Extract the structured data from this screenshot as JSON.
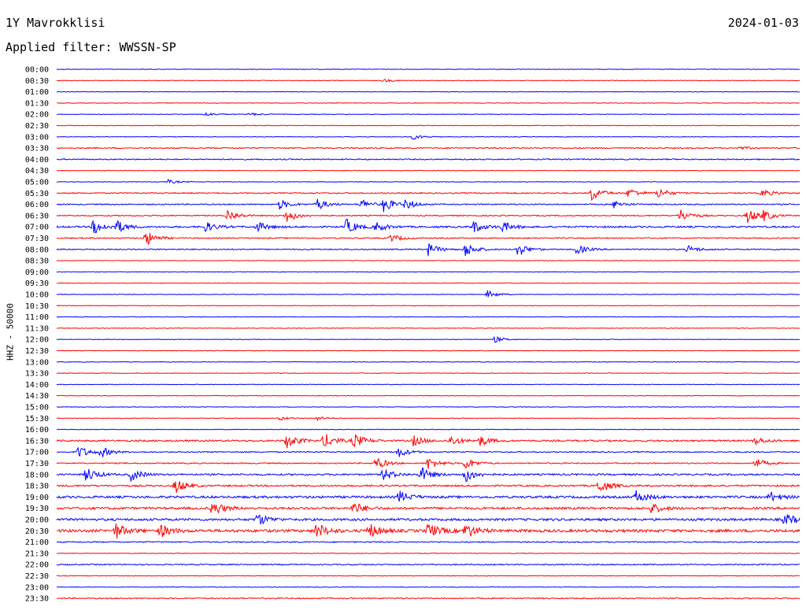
{
  "header": {
    "station": "1Y Mavrokklisi",
    "date": "2024-01-03",
    "filter": "Applied filter: WWSSN-SP"
  },
  "colors": {
    "odd_rows": "#0000ff",
    "even_rows": "#ff0000"
  },
  "chart_data": {
    "type": "line",
    "title": "1Y Mavrokklisi",
    "ylabel": "HHZ - 50000",
    "xlabel": "",
    "row_interval_minutes": 30,
    "rows": [
      {
        "label": "00:00",
        "color": "blue",
        "amplitude": 1,
        "events": []
      },
      {
        "label": "00:30",
        "color": "red",
        "amplitude": 1,
        "events": [
          [
            0.44,
            0.6
          ]
        ]
      },
      {
        "label": "01:00",
        "color": "blue",
        "amplitude": 1,
        "events": []
      },
      {
        "label": "01:30",
        "color": "red",
        "amplitude": 1,
        "events": []
      },
      {
        "label": "02:00",
        "color": "blue",
        "amplitude": 1,
        "events": [
          [
            0.2,
            0.8
          ],
          [
            0.26,
            0.6
          ]
        ]
      },
      {
        "label": "02:30",
        "color": "red",
        "amplitude": 1,
        "events": []
      },
      {
        "label": "03:00",
        "color": "blue",
        "amplitude": 1,
        "events": [
          [
            0.48,
            1.0
          ]
        ]
      },
      {
        "label": "03:30",
        "color": "red",
        "amplitude": 2,
        "events": [
          [
            0.92,
            0.5
          ]
        ]
      },
      {
        "label": "04:00",
        "color": "blue",
        "amplitude": 2,
        "events": []
      },
      {
        "label": "04:30",
        "color": "red",
        "amplitude": 1,
        "events": []
      },
      {
        "label": "05:00",
        "color": "blue",
        "amplitude": 1,
        "events": [
          [
            0.15,
            0.8
          ]
        ]
      },
      {
        "label": "05:30",
        "color": "red",
        "amplitude": 2,
        "events": [
          [
            0.72,
            3.0
          ],
          [
            0.77,
            2.0
          ],
          [
            0.81,
            2.0
          ],
          [
            0.95,
            1.5
          ]
        ]
      },
      {
        "label": "06:00",
        "color": "blue",
        "amplitude": 2,
        "events": [
          [
            0.3,
            2.0
          ],
          [
            0.35,
            2.5
          ],
          [
            0.41,
            2.0
          ],
          [
            0.44,
            3.0
          ],
          [
            0.47,
            2.0
          ],
          [
            0.75,
            1.5
          ]
        ]
      },
      {
        "label": "06:30",
        "color": "red",
        "amplitude": 2,
        "events": [
          [
            0.23,
            2.5
          ],
          [
            0.31,
            2.5
          ],
          [
            0.84,
            2.5
          ],
          [
            0.93,
            3.0
          ],
          [
            0.95,
            2.0
          ]
        ]
      },
      {
        "label": "07:00",
        "color": "blue",
        "amplitude": 3,
        "events": [
          [
            0.05,
            3.0
          ],
          [
            0.08,
            2.5
          ],
          [
            0.2,
            2.0
          ],
          [
            0.27,
            2.0
          ],
          [
            0.39,
            3.0
          ],
          [
            0.43,
            2.0
          ],
          [
            0.56,
            2.5
          ],
          [
            0.6,
            2.0
          ]
        ]
      },
      {
        "label": "07:30",
        "color": "red",
        "amplitude": 2,
        "events": [
          [
            0.12,
            3.0
          ],
          [
            0.45,
            1.5
          ]
        ]
      },
      {
        "label": "08:00",
        "color": "blue",
        "amplitude": 2,
        "events": [
          [
            0.5,
            2.5
          ],
          [
            0.55,
            3.0
          ],
          [
            0.62,
            3.0
          ],
          [
            0.7,
            2.0
          ],
          [
            0.85,
            1.5
          ]
        ]
      },
      {
        "label": "08:30",
        "color": "red",
        "amplitude": 1,
        "events": []
      },
      {
        "label": "09:00",
        "color": "blue",
        "amplitude": 1,
        "events": []
      },
      {
        "label": "09:30",
        "color": "red",
        "amplitude": 1,
        "events": []
      },
      {
        "label": "10:00",
        "color": "blue",
        "amplitude": 1,
        "events": [
          [
            0.58,
            1.5
          ]
        ]
      },
      {
        "label": "10:30",
        "color": "red",
        "amplitude": 1,
        "events": []
      },
      {
        "label": "11:00",
        "color": "blue",
        "amplitude": 1,
        "events": []
      },
      {
        "label": "11:30",
        "color": "red",
        "amplitude": 1,
        "events": []
      },
      {
        "label": "12:00",
        "color": "blue",
        "amplitude": 1,
        "events": [
          [
            0.59,
            1.2
          ]
        ]
      },
      {
        "label": "12:30",
        "color": "red",
        "amplitude": 1,
        "events": []
      },
      {
        "label": "13:00",
        "color": "blue",
        "amplitude": 1,
        "events": []
      },
      {
        "label": "13:30",
        "color": "red",
        "amplitude": 1,
        "events": []
      },
      {
        "label": "14:00",
        "color": "blue",
        "amplitude": 1,
        "events": []
      },
      {
        "label": "14:30",
        "color": "red",
        "amplitude": 1,
        "events": []
      },
      {
        "label": "15:00",
        "color": "blue",
        "amplitude": 1,
        "events": []
      },
      {
        "label": "15:30",
        "color": "red",
        "amplitude": 1,
        "events": [
          [
            0.3,
            0.8
          ],
          [
            0.35,
            0.8
          ]
        ]
      },
      {
        "label": "16:00",
        "color": "blue",
        "amplitude": 1,
        "events": []
      },
      {
        "label": "16:30",
        "color": "red",
        "amplitude": 3,
        "events": [
          [
            0.31,
            3.0
          ],
          [
            0.36,
            3.0
          ],
          [
            0.4,
            3.0
          ],
          [
            0.48,
            2.0
          ],
          [
            0.53,
            2.0
          ],
          [
            0.57,
            2.0
          ],
          [
            0.94,
            1.5
          ]
        ]
      },
      {
        "label": "17:00",
        "color": "blue",
        "amplitude": 2,
        "events": [
          [
            0.03,
            2.5
          ],
          [
            0.06,
            2.0
          ],
          [
            0.46,
            2.0
          ]
        ]
      },
      {
        "label": "17:30",
        "color": "red",
        "amplitude": 2,
        "events": [
          [
            0.43,
            2.5
          ],
          [
            0.5,
            2.5
          ],
          [
            0.55,
            2.5
          ],
          [
            0.94,
            2.0
          ]
        ]
      },
      {
        "label": "18:00",
        "color": "blue",
        "amplitude": 3,
        "events": [
          [
            0.04,
            3.0
          ],
          [
            0.1,
            2.5
          ],
          [
            0.44,
            2.5
          ],
          [
            0.49,
            3.0
          ],
          [
            0.55,
            3.0
          ]
        ]
      },
      {
        "label": "18:30",
        "color": "red",
        "amplitude": 3,
        "events": [
          [
            0.16,
            3.0
          ],
          [
            0.73,
            3.0
          ]
        ]
      },
      {
        "label": "19:00",
        "color": "blue",
        "amplitude": 4,
        "events": [
          [
            0.46,
            2.5
          ],
          [
            0.78,
            2.5
          ],
          [
            0.96,
            2.0
          ]
        ]
      },
      {
        "label": "19:30",
        "color": "red",
        "amplitude": 4,
        "events": [
          [
            0.21,
            3.0
          ],
          [
            0.4,
            2.5
          ],
          [
            0.8,
            2.0
          ]
        ]
      },
      {
        "label": "20:00",
        "color": "blue",
        "amplitude": 4,
        "events": [
          [
            0.27,
            2.5
          ],
          [
            0.98,
            2.5
          ]
        ]
      },
      {
        "label": "20:30",
        "color": "red",
        "amplitude": 5,
        "events": [
          [
            0.08,
            3.0
          ],
          [
            0.14,
            2.5
          ],
          [
            0.35,
            3.0
          ],
          [
            0.42,
            3.0
          ],
          [
            0.5,
            3.0
          ],
          [
            0.55,
            3.0
          ]
        ]
      },
      {
        "label": "21:00",
        "color": "blue",
        "amplitude": 2,
        "events": []
      },
      {
        "label": "21:30",
        "color": "red",
        "amplitude": 1,
        "events": []
      },
      {
        "label": "22:00",
        "color": "blue",
        "amplitude": 2,
        "events": []
      },
      {
        "label": "22:30",
        "color": "red",
        "amplitude": 1,
        "events": []
      },
      {
        "label": "23:00",
        "color": "blue",
        "amplitude": 1,
        "events": []
      },
      {
        "label": "23:30",
        "color": "red",
        "amplitude": 2,
        "events": []
      }
    ]
  }
}
